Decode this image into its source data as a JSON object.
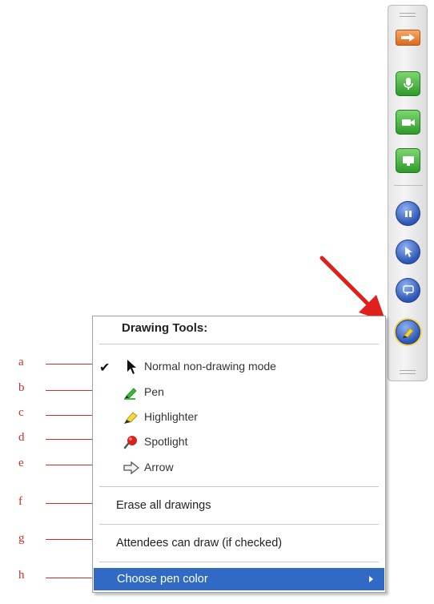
{
  "toolbar": {
    "buttons": [
      {
        "name": "collapse-button",
        "icon": "arrow-right-icon"
      },
      {
        "name": "microphone-button",
        "icon": "microphone-icon"
      },
      {
        "name": "webcam-button",
        "icon": "camera-icon"
      },
      {
        "name": "share-screen-button",
        "icon": "monitor-icon"
      },
      {
        "name": "pause-button",
        "icon": "pause-icon"
      },
      {
        "name": "pointer-button",
        "icon": "cursor-icon"
      },
      {
        "name": "chat-button",
        "icon": "speech-bubble-icon"
      },
      {
        "name": "drawing-tools-button",
        "icon": "highlighter-icon"
      }
    ]
  },
  "callouts": [
    "a",
    "b",
    "c",
    "d",
    "e",
    "f",
    "g",
    "h"
  ],
  "menu": {
    "title": "Drawing Tools:",
    "tools": [
      {
        "label": "Normal non-drawing mode",
        "icon": "cursor-icon",
        "checked": true
      },
      {
        "label": "Pen",
        "icon": "pen-icon",
        "checked": false
      },
      {
        "label": "Highlighter",
        "icon": "highlighter-icon",
        "checked": false
      },
      {
        "label": "Spotlight",
        "icon": "spotlight-icon",
        "checked": false
      },
      {
        "label": "Arrow",
        "icon": "arrow-icon",
        "checked": false
      }
    ],
    "erase_label": "Erase all drawings",
    "attendees_label": "Attendees can draw (if checked)",
    "pen_color_label": "Choose pen color"
  },
  "colors": {
    "accent_red": "#c8322b",
    "menu_highlight": "#316ac5",
    "toolbar_green": "#2e9b2c",
    "toolbar_blue": "#2d56b5",
    "toolbar_orange": "#dc6a1c"
  }
}
